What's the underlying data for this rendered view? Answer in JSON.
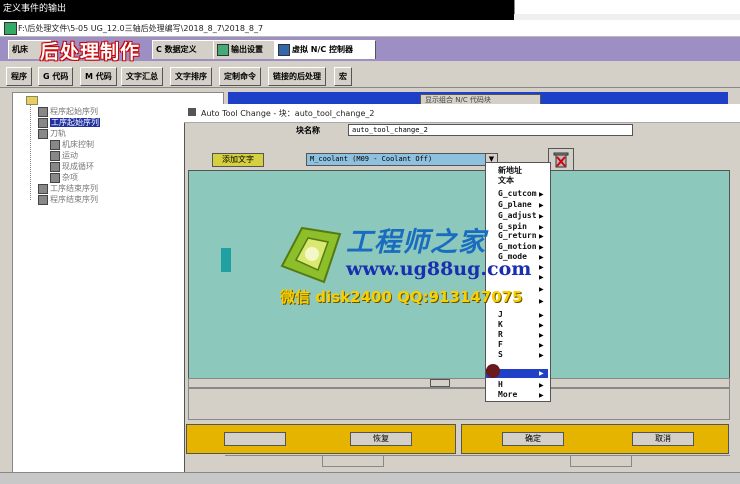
{
  "topbar": {
    "title": "定义事件的输出"
  },
  "window": {
    "path": "F:\\后处理文件\\5-05 UG_12.0三轴后处理编写\\2018_8_7\\2018_8_7"
  },
  "overlay": {
    "title": "后处理制作"
  },
  "tabs_main": [
    {
      "label": "机床"
    },
    {
      "label": "C 数据定义"
    },
    {
      "label": "输出设置"
    },
    {
      "label": "虚拟 N/C 控制器"
    }
  ],
  "tabs_sub": [
    {
      "label": "程序"
    },
    {
      "label": "G 代码"
    },
    {
      "label": "M 代码"
    },
    {
      "label": "文字汇总"
    },
    {
      "label": "文字排序"
    },
    {
      "label": "定制命令"
    },
    {
      "label": "链接的后处理"
    },
    {
      "label": "宏"
    }
  ],
  "tree": [
    {
      "label": "程序起始序列"
    },
    {
      "label": "工序起始序列"
    },
    {
      "label": "刀轨"
    },
    {
      "label": "机床控制"
    },
    {
      "label": "运动"
    },
    {
      "label": "现成循环"
    },
    {
      "label": "杂项"
    },
    {
      "label": "工序结束序列"
    },
    {
      "label": "程序结束序列"
    }
  ],
  "right_panel": {
    "show_codes_label": "显示组合 N/C 代码块"
  },
  "dialog": {
    "title": "Auto Tool Change - 块：auto_tool_change_2",
    "block_name_label": "块名称",
    "block_name_value": "auto_tool_change_2",
    "add_text_label": "添加文字",
    "coolant_value": "M_coolant (M09 - Coolant Off)",
    "restore_label": "恢复",
    "ok_label": "确定",
    "cancel_label": "取消"
  },
  "popup_menu": {
    "items": [
      "新地址",
      "文本",
      "G_cutcom",
      "G_plane",
      "G_adjust",
      "G_spin",
      "G_return",
      "G_motion",
      "G_mode",
      "J",
      "K",
      "R",
      "F",
      "S",
      "H",
      "More"
    ]
  },
  "watermark": {
    "cn": "工程师之家",
    "url": "www.ug88ug.com",
    "contact": "微信 disk2400 QQ:913147075"
  },
  "colors": {
    "accent": "#2040c8",
    "tab_bar": "#9d8fc4",
    "edit_bg": "#8cc8bc",
    "button_yellow": "#e4b400"
  }
}
